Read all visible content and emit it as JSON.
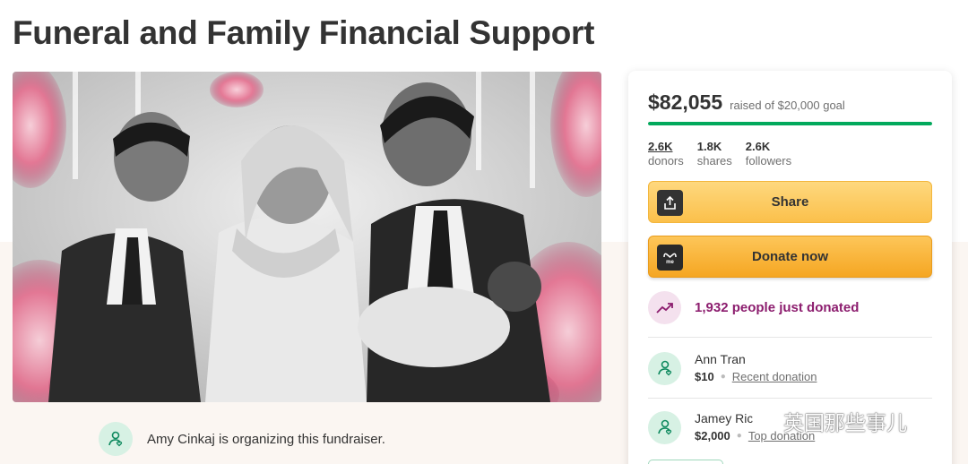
{
  "page": {
    "title": "Funeral and Family Financial Support"
  },
  "organizer": {
    "text": "Amy Cinkaj is organizing this fundraiser."
  },
  "donation_card": {
    "amount": "$82,055",
    "goal_text": "raised of $20,000 goal",
    "progress_fraction": 1.0,
    "stats": [
      {
        "value": "2.6K",
        "label": "donors"
      },
      {
        "value": "1.8K",
        "label": "shares"
      },
      {
        "value": "2.6K",
        "label": "followers"
      }
    ],
    "share_label": "Share",
    "donate_label": "Donate now",
    "trend_text": "1,932 people just donated",
    "donations": [
      {
        "name": "Ann Tran",
        "amount": "$10",
        "tag": "Recent donation"
      },
      {
        "name": "Jamey Ric",
        "amount": "$2,000",
        "tag": "Top donation"
      }
    ]
  },
  "colors": {
    "accent_green": "#02a95c",
    "donate_orange": "#f5a622",
    "trend_purple": "#8c1d6e"
  },
  "watermark": {
    "text": "英国那些事儿"
  }
}
